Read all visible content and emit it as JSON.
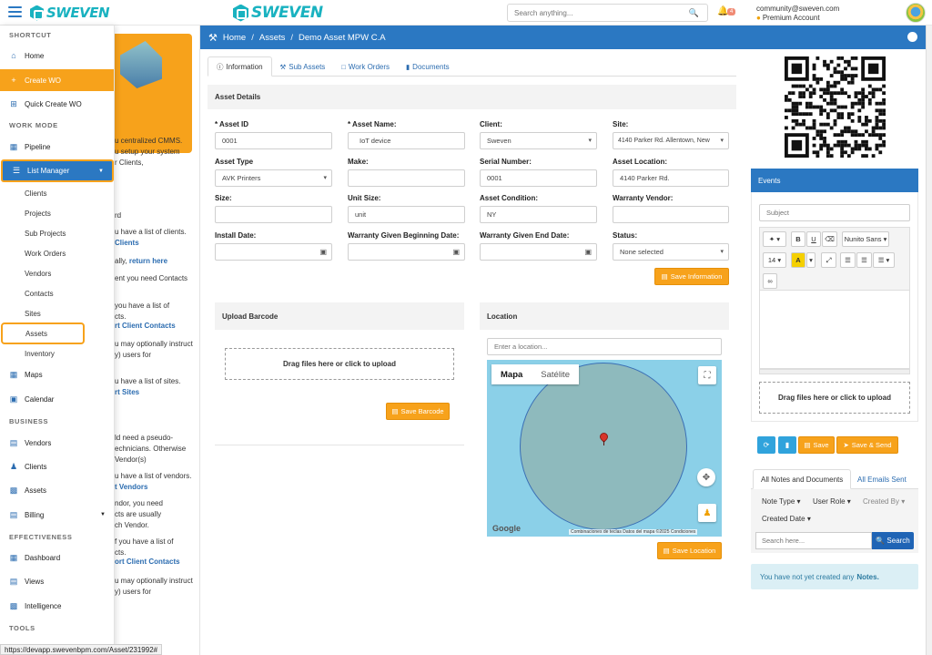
{
  "brand": {
    "name": "SWEVEN"
  },
  "topbar": {
    "search_placeholder": "Search anything...",
    "notification_count": "4",
    "user_email": "community@sweven.com",
    "user_plan": "Premium Account"
  },
  "sidebar": {
    "sections": {
      "shortcut": "SHORTCUT",
      "work_mode": "WORK MODE",
      "business": "BUSINESS",
      "effectiveness": "EFFECTIVENESS",
      "tools": "TOOLS"
    },
    "items": {
      "home": "Home",
      "create_wo": "Create WO",
      "quick_create_wo": "Quick Create WO",
      "pipeline": "Pipeline",
      "list_manager": "List Manager",
      "maps": "Maps",
      "calendar": "Calendar",
      "vendors": "Vendors",
      "clients": "Clients",
      "assets": "Assets",
      "billing": "Billing",
      "dashboard": "Dashboard",
      "views": "Views",
      "intelligence": "Intelligence"
    },
    "list_manager_sub": [
      "Clients",
      "Projects",
      "Sub Projects",
      "Work Orders",
      "Vendors",
      "Contacts",
      "Sites",
      "Assets",
      "Inventory"
    ]
  },
  "intro_panel": {
    "lines": [
      {
        "text": "u centralized CMMS.",
        "link": ""
      },
      {
        "text": "u setup your system",
        "link": ""
      },
      {
        "text": "r Clients,",
        "link": ""
      },
      {
        "text": "rd",
        "link": ""
      },
      {
        "text": "u have a list of clients.",
        "link": ""
      },
      {
        "text": "",
        "link": "Clients"
      },
      {
        "text": "ally, ",
        "link": "return here"
      },
      {
        "text": "ent you need Contacts",
        "link": ""
      },
      {
        "text": "you have a list of",
        "link": ""
      },
      {
        "text": "cts.",
        "link": ""
      },
      {
        "text": "",
        "link": "rt Client Contacts"
      },
      {
        "text": "u may optionally instruct",
        "link": ""
      },
      {
        "text": "y) users for",
        "link": ""
      },
      {
        "text": "u have a list of sites.",
        "link": ""
      },
      {
        "text": "",
        "link": "rt Sites"
      },
      {
        "text": "ld need a pseudo-",
        "link": ""
      },
      {
        "text": "echnicians. Otherwise",
        "link": ""
      },
      {
        "text": "Vendor(s)",
        "link": ""
      },
      {
        "text": "u have a list of vendors.",
        "link": ""
      },
      {
        "text": "",
        "link": "t Vendors"
      },
      {
        "text": "ndor, you need",
        "link": ""
      },
      {
        "text": "cts are usually",
        "link": ""
      },
      {
        "text": "ch Vendor.",
        "link": ""
      },
      {
        "text": "f you have a list of",
        "link": ""
      },
      {
        "text": "cts.",
        "link": ""
      },
      {
        "text": "",
        "link": "ort Client Contacts"
      },
      {
        "text": "u may optionally instruct",
        "link": ""
      },
      {
        "text": "y) users for",
        "link": ""
      }
    ]
  },
  "breadcrumb": {
    "home": "Home",
    "section": "Assets",
    "current": "Demo Asset MPW C.A"
  },
  "tabs": {
    "information": "Information",
    "sub_assets": "Sub Assets",
    "work_orders": "Work Orders",
    "documents": "Documents"
  },
  "asset_details": {
    "title": "Asset Details",
    "fields": {
      "asset_id": {
        "label": "* Asset ID",
        "value": "0001"
      },
      "asset_name": {
        "label": "* Asset Name:",
        "value": "IoT device"
      },
      "client": {
        "label": "Client:",
        "value": "Sweven"
      },
      "site": {
        "label": "Site:",
        "value": "4140 Parker Rd. Allentown, New"
      },
      "asset_type": {
        "label": "Asset Type",
        "value": "AVK Printers"
      },
      "make": {
        "label": "Make:",
        "value": ""
      },
      "serial_number": {
        "label": "Serial Number:",
        "value": "0001"
      },
      "asset_location": {
        "label": "Asset Location:",
        "value": "4140 Parker Rd."
      },
      "size": {
        "label": "Size:",
        "value": ""
      },
      "unit_size": {
        "label": "Unit Size:",
        "value": "unit"
      },
      "asset_condition": {
        "label": "Asset Condition:",
        "value": "NY"
      },
      "warranty_vendor": {
        "label": "Warranty Vendor:",
        "value": ""
      },
      "install_date": {
        "label": "Install Date:",
        "value": ""
      },
      "warranty_begin": {
        "label": "Warranty Given Beginning Date:",
        "value": ""
      },
      "warranty_end": {
        "label": "Warranty Given End Date:",
        "value": ""
      },
      "status": {
        "label": "Status:",
        "value": "None selected"
      }
    },
    "save_button": "Save Information"
  },
  "upload_barcode": {
    "title": "Upload Barcode",
    "dropzone": "Drag files here or click to upload",
    "save_button": "Save Barcode"
  },
  "location": {
    "title": "Location",
    "placeholder": "Enter a location...",
    "map_type_map": "Mapa",
    "map_type_sat": "Satélite",
    "attribution": "Combinaciones de teclas    Datos del mapa ©2025    Condiciones",
    "google": "Google",
    "save_button": "Save Location"
  },
  "events": {
    "title": "Events",
    "subject_placeholder": "Subject",
    "font_name": "Nunito Sans",
    "font_size": "14",
    "dropzone": "Drag files here or click to upload",
    "save_button": "Save",
    "save_send_button": "Save & Send"
  },
  "notes": {
    "tab_all_notes": "All Notes and Documents",
    "tab_all_emails": "All Emails Sent",
    "filters": {
      "note_type": "Note Type",
      "user_role": "User Role",
      "created_by": "Created By",
      "created_date": "Created Date"
    },
    "search_placeholder": "Search here...",
    "search_button": "Search",
    "empty_text": "You have not yet created any",
    "empty_bold": "Notes."
  },
  "status_url": "https://devapp.swevenbpm.com/Asset/231992#"
}
